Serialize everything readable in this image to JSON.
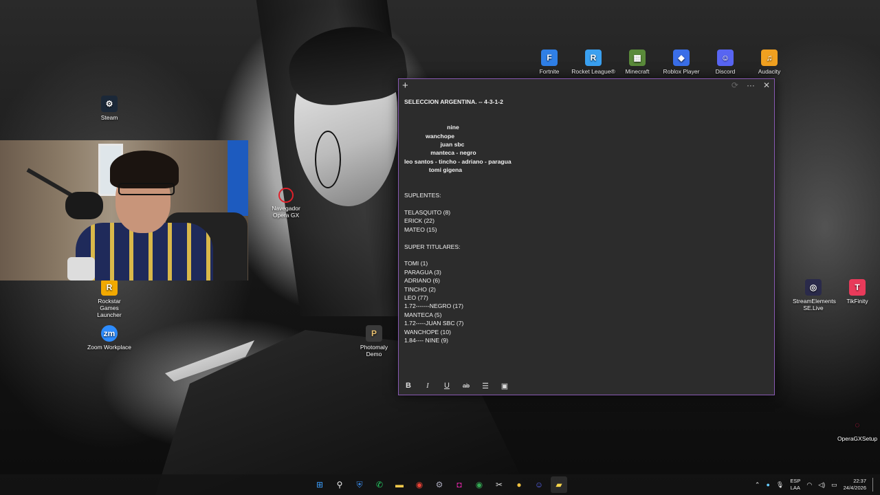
{
  "desktop_icons": [
    {
      "label": "Fortnite",
      "icon": "fortnite-icon",
      "color": "#2f7fe6"
    },
    {
      "label": "Rocket League®",
      "icon": "rocket-league-icon",
      "color": "#3aa0f0"
    },
    {
      "label": "Minecraft",
      "icon": "minecraft-icon",
      "color": "#5a8a3a"
    },
    {
      "label": "Roblox Player",
      "icon": "roblox-icon",
      "color": "#3a6ee8"
    },
    {
      "label": "Discord",
      "icon": "discord-icon",
      "color": "#5865f2"
    },
    {
      "label": "Audacity",
      "icon": "audacity-icon",
      "color": "#f0a020"
    },
    {
      "label": "Steam",
      "icon": "steam-icon",
      "color": "#1b2838"
    },
    {
      "label": "Navegador Opera GX",
      "icon": "opera-gx-icon",
      "color": "#e0202a"
    },
    {
      "label": "Rockstar Games Launcher",
      "icon": "rockstar-icon",
      "color": "#f2a900"
    },
    {
      "label": "Zoom Workplace",
      "icon": "zoom-icon",
      "color": "#2d8cff"
    },
    {
      "label": "Photomaly Demo",
      "icon": "photomaly-icon",
      "color": "#3a3a3a"
    },
    {
      "label": "StreamElements SE.Live",
      "icon": "streamelements-icon",
      "color": "#2a2a4a"
    },
    {
      "label": "TikFinity",
      "icon": "tikfinity-icon",
      "color": "#e83a5a"
    },
    {
      "label": "OperaGXSetup",
      "icon": "operagx-setup-icon",
      "color": "#e02050"
    }
  ],
  "notes": {
    "lines": [
      {
        "text": "SELECCION ARGENTINA. -- 4-3-1-2",
        "bold": true
      },
      {
        "text": "",
        "bold": false
      },
      {
        "text": "",
        "bold": false
      },
      {
        "text": "                          nine",
        "bold": true
      },
      {
        "text": "             wanchope",
        "bold": true
      },
      {
        "text": "                      juan sbc",
        "bold": true
      },
      {
        "text": "                manteca - negro",
        "bold": true
      },
      {
        "text": "leo santos - tincho - adriano - paragua",
        "bold": true
      },
      {
        "text": "               tomi gigena",
        "bold": true
      },
      {
        "text": "",
        "bold": false
      },
      {
        "text": "",
        "bold": false
      },
      {
        "text": "SUPLENTES:",
        "bold": false
      },
      {
        "text": "",
        "bold": false
      },
      {
        "text": "TELASQUITO (8)",
        "bold": false
      },
      {
        "text": "ERICK (22)",
        "bold": false
      },
      {
        "text": "MATEO (15)",
        "bold": false
      },
      {
        "text": "",
        "bold": false
      },
      {
        "text": "SUPER TITULARES:",
        "bold": false
      },
      {
        "text": "",
        "bold": false
      },
      {
        "text": "TOMI (1)",
        "bold": false
      },
      {
        "text": "PARAGUA (3)",
        "bold": false
      },
      {
        "text": "ADRIANO (6)",
        "bold": false
      },
      {
        "text": "TINCHO (2)",
        "bold": false
      },
      {
        "text": "LEO (77)",
        "bold": false
      },
      {
        "text": "1.72-------NEGRO (17)",
        "bold": false
      },
      {
        "text": "MANTECA (5)",
        "bold": false
      },
      {
        "text": "1.72-----JUAN SBC (7)",
        "bold": false
      },
      {
        "text": "WANCHOPE (10)",
        "bold": false
      },
      {
        "text": "1.84---- NINE (9)",
        "bold": false
      }
    ],
    "toolbar": {
      "bold": "B",
      "italic": "I",
      "underline": "U",
      "strikethrough": "ab",
      "list": "☰",
      "image": "▣"
    },
    "titlebar": {
      "add": "+",
      "sync": "⟳",
      "more": "···",
      "close": "✕"
    }
  },
  "taskbar": {
    "apps": [
      "start-icon",
      "search-icon",
      "defender-icon",
      "whatsapp-icon",
      "file-explorer-icon",
      "chrome-icon",
      "settings-icon",
      "instagram-icon",
      "chrome-2-icon",
      "snipping-icon",
      "app-icon",
      "discord-icon",
      "sticky-notes-icon"
    ],
    "language_top": "ESP",
    "language_bottom": "LAA",
    "time": "22:37",
    "date": "24/4/2026"
  }
}
